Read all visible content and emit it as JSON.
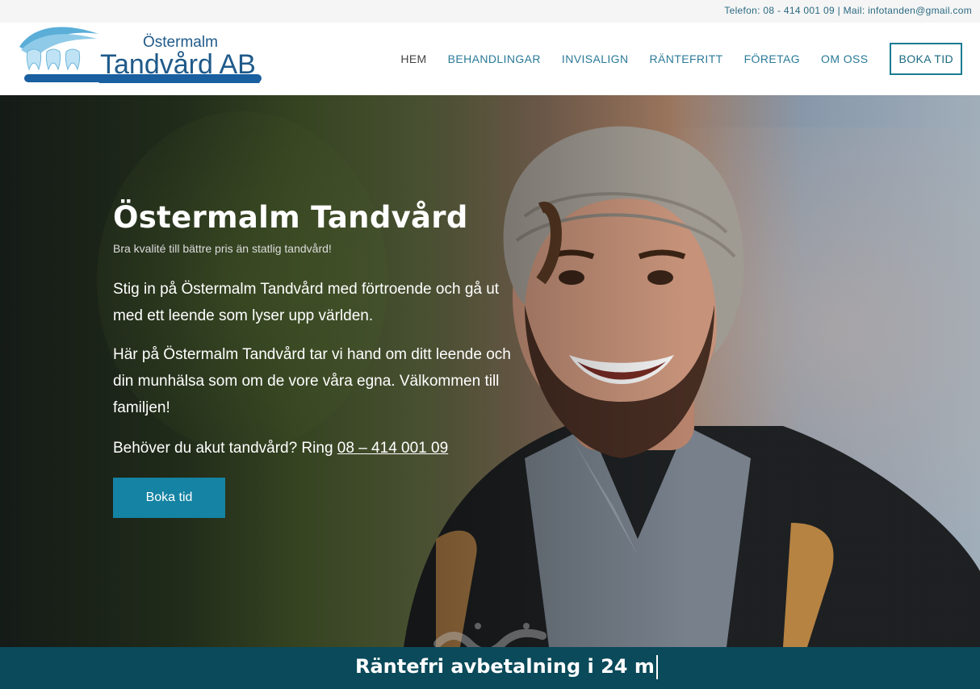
{
  "topbar": {
    "contact": "Telefon: 08 - 414 001 09 | Mail: infotanden@gmail.com"
  },
  "logo": {
    "line1": "Östermalm",
    "line2": "Tandvård AB"
  },
  "nav": {
    "items": [
      "HEM",
      "BEHANDLINGAR",
      "INVISALIGN",
      "RÄNTEFRITT",
      "FÖRETAG",
      "OM OSS"
    ],
    "cta": "BOKA TID",
    "active_index": 0
  },
  "hero": {
    "title": "Östermalm Tandvård",
    "tagline": "Bra kvalité till bättre pris än statlig tandvård!",
    "para1": "Stig in på Östermalm Tandvård med förtroende och gå ut med ett leende som lyser upp världen.",
    "para2": "Här på Östermalm Tandvård tar vi hand om ditt leende och din munhälsa som om de vore våra egna. Välkommen till familjen!",
    "para3_prefix": "Behöver du akut tandvård? Ring ",
    "phone": "08 – 414 001 09",
    "button": "Boka tid"
  },
  "banner": {
    "text": "Räntefri avbetalning i 24 m"
  },
  "colors": {
    "accent": "#1583a3",
    "nav_text": "#2b7a98",
    "banner_bg": "#0a4a5a"
  },
  "icons": {
    "logo_graphic": "tooth-toothbrush-logo",
    "watermark": "mostaql-watermark"
  }
}
